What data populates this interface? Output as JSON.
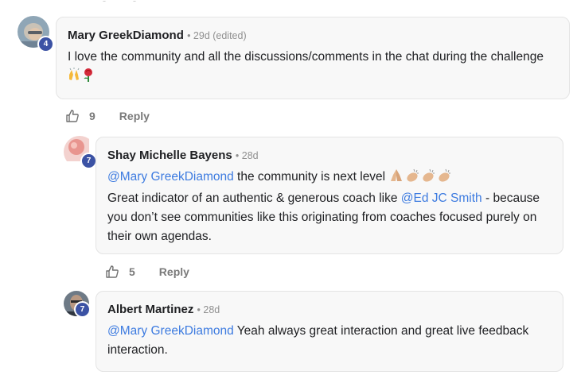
{
  "comments": [
    {
      "author": "Mary GreekDiamond",
      "meta": "• 29d (edited)",
      "level": "4",
      "avatar_icon": "user-avatar-photo",
      "body": "I love the community and all the discussions/comments in the chat during the challenge",
      "emoji": [
        "raising-hands-emoji",
        "rose-emoji"
      ],
      "likes": "9",
      "reply_label": "Reply"
    },
    {
      "author": "Shay Michelle Bayens",
      "meta": "• 28d",
      "level": "7",
      "avatar_icon": "user-avatar-photo",
      "line1_mention": "@Mary GreekDiamond",
      "line1_text": "the community is next level",
      "line2_text": "Great indicator of an authentic & generous coach like",
      "line2_mention": "@Ed JC Smith",
      "line2_rest": "- because you don’t see communities like this originating from coaches focused purely on their own agendas.",
      "emoji": [
        "folded-hands-emoji",
        "clapping-hands-emoji",
        "clapping-hands-emoji",
        "clapping-hands-emoji"
      ],
      "likes": "5",
      "reply_label": "Reply"
    },
    {
      "author": "Albert Martinez",
      "meta": "• 28d",
      "level": "7",
      "avatar_icon": "user-avatar-photo",
      "mention": "@Mary GreekDiamond",
      "body": "Yeah always great interaction and great live feedback interaction."
    }
  ],
  "colors": {
    "mention": "#3d7be0",
    "level_badge": "#3b52a4",
    "bubble_bg": "#f8f8f8"
  }
}
